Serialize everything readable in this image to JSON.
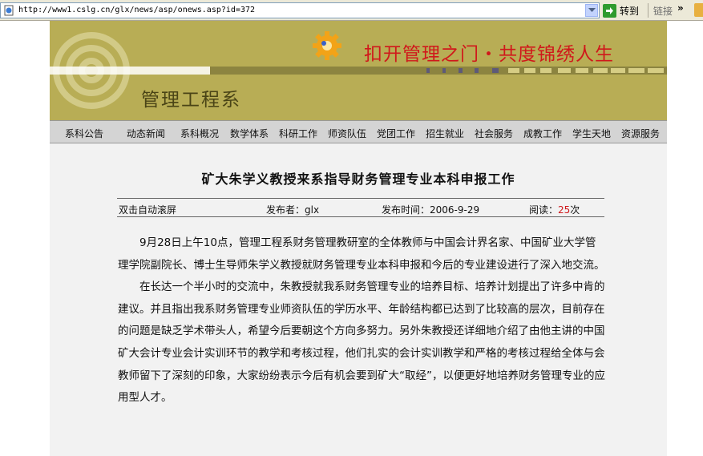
{
  "browser": {
    "address": "http://www1.cslg.cn/glx/news/asp/onews.asp?id=372",
    "go_label": "转到",
    "links_label": "链接",
    "links_chevron": "»"
  },
  "header": {
    "slogan": "扣开管理之门・共度锦绣人生",
    "department": "管理工程系"
  },
  "nav": {
    "items": [
      "系科公告",
      "动态新闻",
      "系科概况",
      "数学体系",
      "科研工作",
      "师资队伍",
      "党团工作",
      "招生就业",
      "社会服务",
      "成教工作",
      "学生天地",
      "资源服务"
    ]
  },
  "article": {
    "title": "矿大朱学义教授来系指导财务管理专业本科申报工作",
    "meta": {
      "autoscroll": "双击自动滚屏",
      "publisher": "发布者：glx",
      "time": "发布时间：2006-9-29",
      "reads_label": "阅读：",
      "reads_count": "25",
      "reads_unit": "次"
    },
    "paragraphs": [
      "9月28日上午10点，管理工程系财务管理教研室的全体教师与中国会计界名家、中国矿业大学管理学院副院长、博士生导师朱学义教授就财务管理专业本科申报和今后的专业建设进行了深入地交流。",
      "在长达一个半小时的交流中，朱教授就我系财务管理专业的培养目标、培养计划提出了许多中肯的建议。并且指出我系财务管理专业师资队伍的学历水平、年龄结构都已达到了比较高的层次，目前存在的问题是缺乏学术带头人，希望今后要朝这个方向多努力。另外朱教授还详细地介绍了由他主讲的中国矿大会计专业会计实训环节的教学和考核过程，他们扎实的会计实训教学和严格的考核过程给全体与会教师留下了深刻的印象，大家纷纷表示今后有机会要到矿大“取经”，以便更好地培养财务管理专业的应用型人才。"
    ]
  },
  "colors": {
    "banner": "#b8ad55",
    "slogan": "#d0181b",
    "nav_bg": "#d4d4d4",
    "page_bg": "#f2f2f2"
  }
}
